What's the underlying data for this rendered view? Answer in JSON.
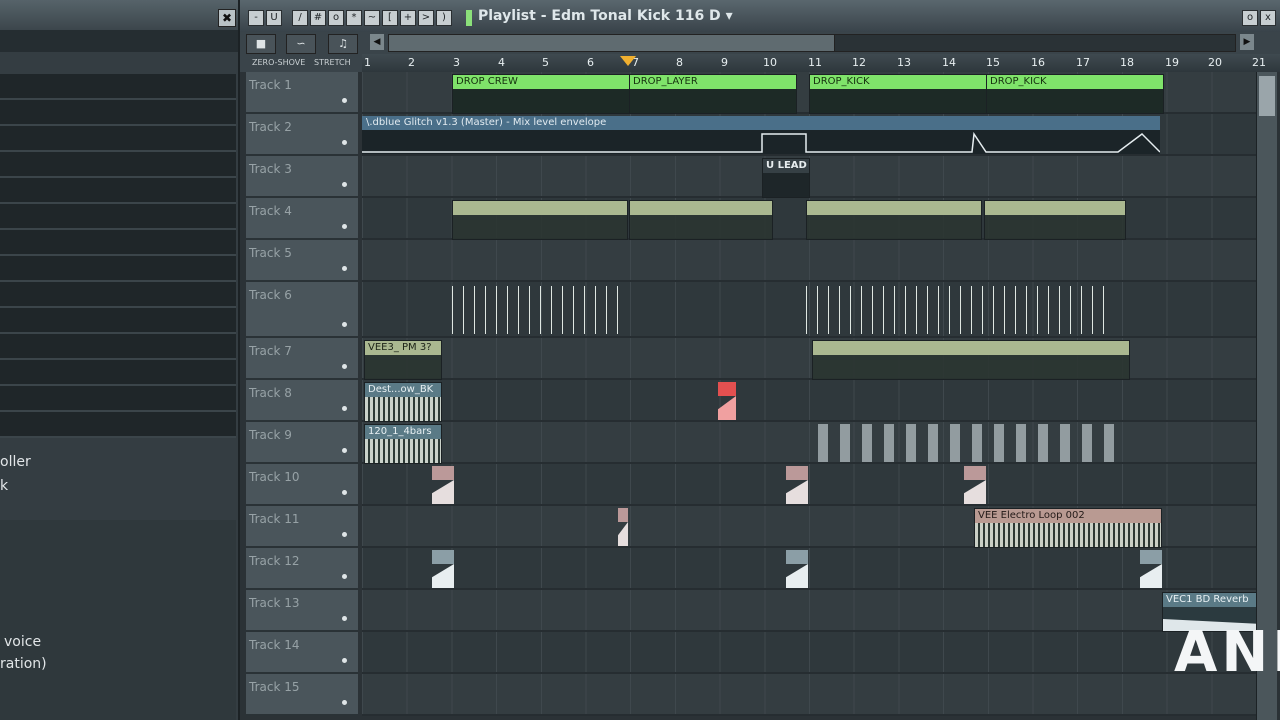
{
  "window": {
    "title": "Playlist - Edm Tonal Kick 116 D",
    "title_suffix": "▾"
  },
  "left_panel": {
    "close_label": "✖",
    "texts": [
      "oller",
      "k",
      "voice",
      "ration)"
    ]
  },
  "toolbar": {
    "snap_options": [
      "ZERO-SHOVE",
      "STRETCH"
    ]
  },
  "ruler": {
    "bars": [
      "1",
      "2",
      "3",
      "4",
      "5",
      "6",
      "7",
      "8",
      "9",
      "10",
      "11",
      "12",
      "13",
      "14",
      "15",
      "16",
      "17",
      "18",
      "19",
      "20",
      "21"
    ]
  },
  "tracks": [
    "Track 1",
    "Track 2",
    "Track 3",
    "Track 4",
    "Track 5",
    "Track 6",
    "Track 7",
    "Track 8",
    "Track 9",
    "Track 10",
    "Track 11",
    "Track 12",
    "Track 13",
    "Track 14",
    "Track 15"
  ],
  "clips": {
    "track1": [
      "DROP CREW",
      "DROP_LAYER",
      "DROP_KICK",
      "DROP_KICK"
    ],
    "envelope": "\\.dblue Glitch v1.3 (Master) - Mix level envelope",
    "lead": "U LEAD",
    "vee3": "VEE3_ PM 3?",
    "dest": "Dest...ow_BK",
    "bars120": "120_1_4bars",
    "electro": "VEE Electro Loop 002",
    "reverb": "VEC1 BD Reverb"
  },
  "watermark": "ANN",
  "colors": {
    "accent_green": "#7fe36a",
    "envelope_blue": "#4a6f89",
    "marker": "#f0b030"
  }
}
